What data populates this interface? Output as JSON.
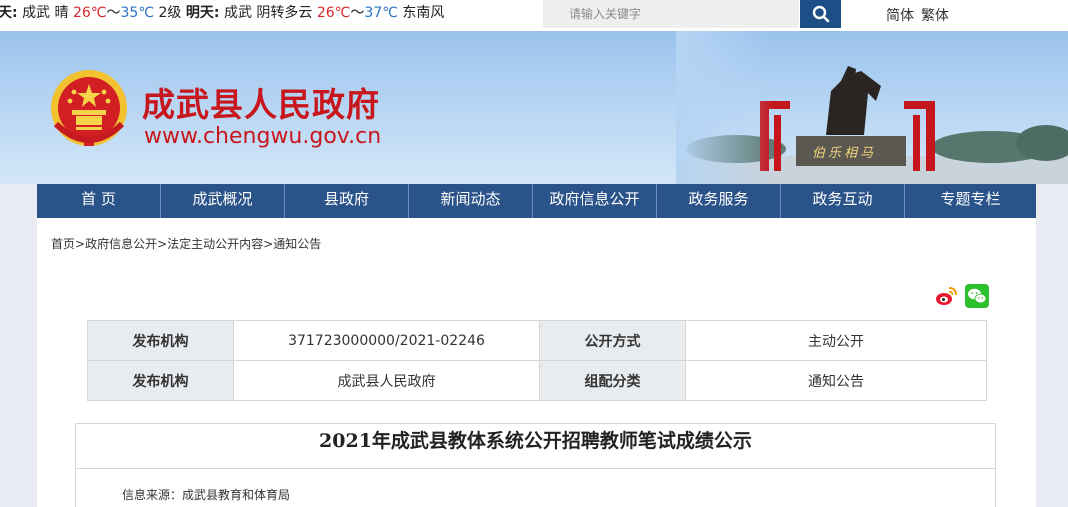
{
  "weather": {
    "today_label": "今天:",
    "today_city": "成武",
    "today_cond": "晴",
    "today_high": "26℃",
    "today_sep": "～",
    "today_low": "35℃",
    "today_wind": "2级",
    "tomorrow_label": "明天:",
    "tomorrow_city": "成武",
    "tomorrow_cond": "阴转多云",
    "tomorrow_high": "26℃",
    "tomorrow_sep": "～",
    "tomorrow_low": "37℃",
    "tomorrow_wind": "东南风"
  },
  "search": {
    "placeholder": "请输入关键字"
  },
  "lang": {
    "simplified": "简体",
    "traditional": "繁体"
  },
  "header": {
    "title": "成武县人民政府",
    "url": "www.chengwu.gov.cn",
    "stone_text": "伯乐相马"
  },
  "nav": [
    "首 页",
    "成武概况",
    "县政府",
    "新闻动态",
    "政府信息公开",
    "政务服务",
    "政务互动",
    "专题专栏"
  ],
  "breadcrumb": [
    "首页",
    "政府信息公开",
    "法定主动公开内容",
    "通知公告"
  ],
  "breadcrumb_sep": ">",
  "share_icons": [
    "weibo-icon",
    "wechat-icon"
  ],
  "info_table": {
    "row1": {
      "label1": "发布机构",
      "value1": "371723000000/2021-02246",
      "label2": "公开方式",
      "value2": "主动公开"
    },
    "row2": {
      "label1": "发布机构",
      "value1": "成武县人民政府",
      "label2": "组配分类",
      "value2": "通知公告"
    }
  },
  "article": {
    "title": "2021年成武县教体系统公开招聘教师笔试成绩公示",
    "source": "信息来源：成武县教育和体育局"
  },
  "colors": {
    "brand_red": "#c8161d",
    "nav_blue": "#2a5389",
    "search_btn": "#1d4e86",
    "banner_sky": "#9ac2ec"
  }
}
